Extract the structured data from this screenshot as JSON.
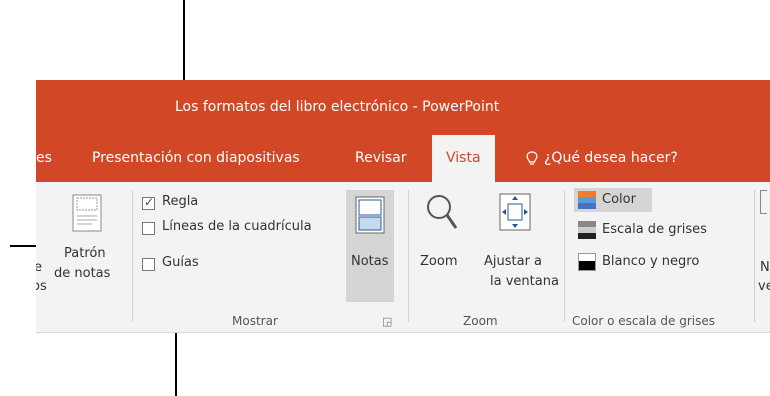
{
  "window": {
    "title": "Los formatos del libro electrónico - PowerPoint"
  },
  "tabs": {
    "partial_left": "es",
    "slideshow": "Presentación con diapositivas",
    "review": "Revisar",
    "view": "Vista",
    "tell_me": "¿Qué desea hacer?"
  },
  "ribbon": {
    "master_views": {
      "partial_text_1": "e",
      "partial_text_2": "os",
      "notes_master_line1": "Patrón",
      "notes_master_line2": "de notas"
    },
    "show": {
      "ruler": {
        "label": "Regla",
        "checked": true
      },
      "gridlines": {
        "label": "Líneas de la cuadrícula",
        "checked": false
      },
      "guides": {
        "label": "Guías",
        "checked": false
      },
      "notes": "Notas",
      "group_label": "Mostrar"
    },
    "zoom": {
      "zoom": "Zoom",
      "fit_line1": "Ajustar a",
      "fit_line2": "la ventana",
      "group_label": "Zoom"
    },
    "color": {
      "color": "Color",
      "grayscale": "Escala de grises",
      "bw": "Blanco y negro",
      "group_label": "Color o escala de grises"
    },
    "partial_right": {
      "line1": "N",
      "line2": "ve"
    }
  },
  "colors": {
    "accent": "#d24726",
    "ribbon_bg": "#f3f3f3"
  }
}
